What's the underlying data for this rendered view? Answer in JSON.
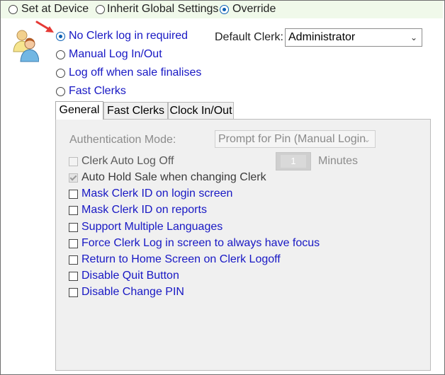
{
  "scope": {
    "options": [
      "Set at Device",
      "Inherit Global Settings",
      "Override"
    ],
    "selected": "Override"
  },
  "login_modes": {
    "options": [
      "No Clerk log in required",
      "Manual Log In/Out",
      "Log off when sale finalises",
      "Fast Clerks"
    ],
    "selected": "No Clerk log in required"
  },
  "default_clerk": {
    "label": "Default Clerk:",
    "value": "Administrator"
  },
  "tabs": [
    "General",
    "Fast Clerks",
    "Clock In/Out"
  ],
  "active_tab": "General",
  "general": {
    "auth_mode_label": "Authentication Mode:",
    "auth_mode_value": "Prompt for Pin (Manual Login",
    "minutes_value": "1",
    "minutes_label": "Minutes",
    "checkboxes": [
      {
        "label": "Clerk Auto Log Off",
        "checked": false,
        "enabled": false
      },
      {
        "label": "Auto Hold Sale when changing Clerk",
        "checked": true,
        "enabled": false
      },
      {
        "label": "Mask Clerk ID on login screen",
        "checked": false,
        "enabled": true
      },
      {
        "label": "Mask Clerk ID on reports",
        "checked": false,
        "enabled": true
      },
      {
        "label": "Support Multiple Languages",
        "checked": false,
        "enabled": true
      },
      {
        "label": "Force Clerk Log in screen to always have focus",
        "checked": false,
        "enabled": true
      },
      {
        "label": "Return to Home Screen on Clerk Logoff",
        "checked": false,
        "enabled": true
      },
      {
        "label": "Disable Quit Button",
        "checked": false,
        "enabled": true
      },
      {
        "label": "Disable Change PIN",
        "checked": false,
        "enabled": true
      }
    ]
  },
  "icons": {
    "users": "users-icon",
    "annotation": "red-arrow-icon"
  },
  "colors": {
    "topbar": "#f0f9ea",
    "link_text": "#1818c4",
    "radio_selected": "#0a5fb4",
    "arrow": "#e53935"
  }
}
